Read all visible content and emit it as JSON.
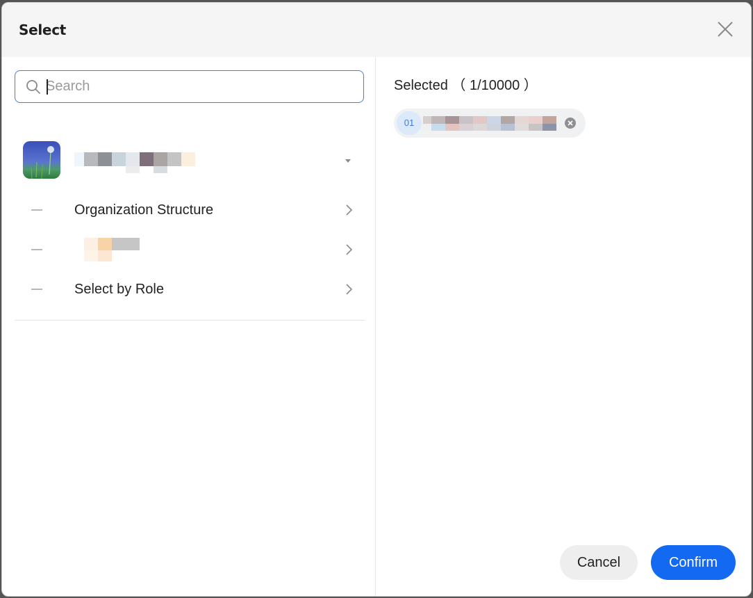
{
  "dialog": {
    "title": "Select",
    "close_icon": "close-icon"
  },
  "search": {
    "placeholder": "Search",
    "value": "",
    "icon": "search-icon"
  },
  "organization": {
    "name": "",
    "avatar": "dandelion-photo",
    "expand_icon": "caret-down-icon"
  },
  "nav_items": [
    {
      "label": "Organization Structure",
      "icon": "chevron-right-icon"
    },
    {
      "label": "",
      "icon": "chevron-right-icon"
    },
    {
      "label": "Select by Role",
      "icon": "chevron-right-icon"
    }
  ],
  "selected": {
    "title": "Selected （ 1/10000 ）",
    "items": [
      {
        "badge": "01",
        "name": "",
        "remove_icon": "close-circle-icon"
      }
    ]
  },
  "footer": {
    "cancel_label": "Cancel",
    "confirm_label": "Confirm"
  },
  "colors": {
    "accent": "#1369f1",
    "search_border": "#3a7ee8",
    "header_bg": "#f5f5f5",
    "chip_bg": "#f0f1f3",
    "badge_bg": "#dce9fb"
  }
}
